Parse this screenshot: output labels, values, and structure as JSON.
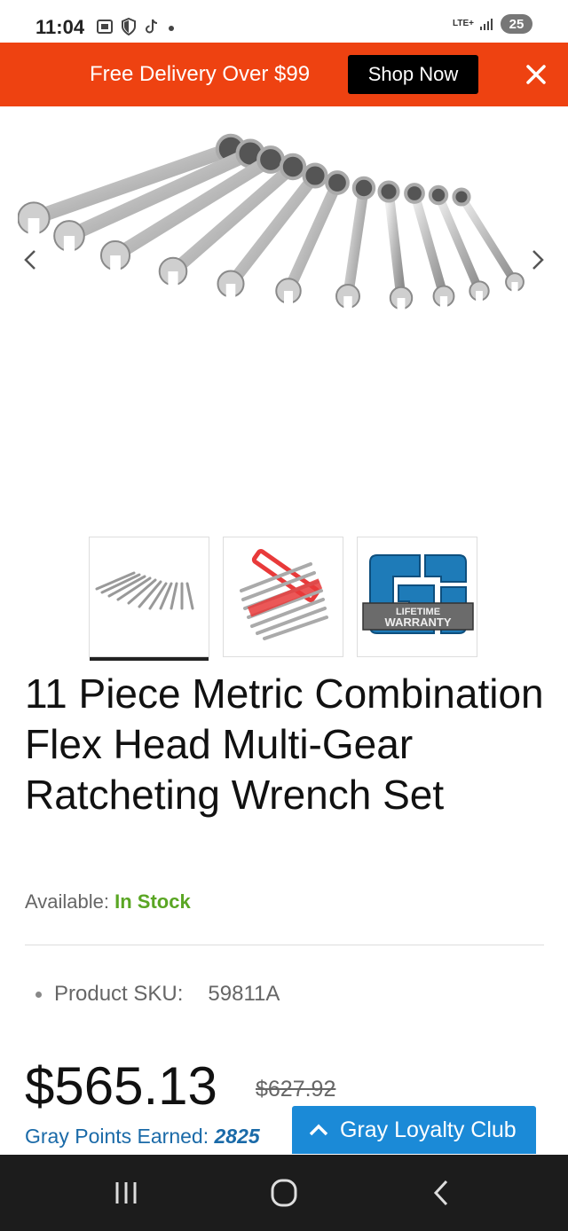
{
  "status_bar": {
    "time": "11:04",
    "network": "LTE+",
    "battery": "25",
    "icons": [
      "screenshot-icon",
      "shield-icon",
      "tiktok-icon",
      "dot-icon",
      "signal-icon"
    ]
  },
  "promo": {
    "text": "Free Delivery Over $99",
    "button_label": "Shop Now",
    "close_icon": "close-icon",
    "background": "#ee4211"
  },
  "hero": {
    "prev_icon": "chevron-left-icon",
    "next_icon": "chevron-right-icon"
  },
  "thumbnails": [
    {
      "name": "wrench-set-thumb",
      "active": true
    },
    {
      "name": "wrench-rack-thumb",
      "active": false
    },
    {
      "name": "lifetime-warranty-thumb",
      "active": false,
      "badge_line1": "LIFETIME",
      "badge_line2": "WARRANTY"
    }
  ],
  "product": {
    "title": "11 Piece Metric Combination Flex Head Multi-Gear Ratcheting Wrench Set",
    "availability_label": "Available:",
    "availability_value": "In Stock",
    "sku_label": "Product SKU:",
    "sku_value": "59811A",
    "price": "$565.13",
    "old_price": "$627.92",
    "points_label": "Gray Points Earned:",
    "points_value": "2825"
  },
  "loyalty": {
    "label": "Gray Loyalty Club",
    "icon": "chevron-up-icon"
  },
  "nav": {
    "recents_icon": "recents-icon",
    "home_icon": "home-icon",
    "back_icon": "back-icon"
  },
  "colors": {
    "accent": "#ee4211",
    "in_stock": "#5aa624",
    "points": "#1a6aa8",
    "loyalty": "#1b8ad7"
  }
}
